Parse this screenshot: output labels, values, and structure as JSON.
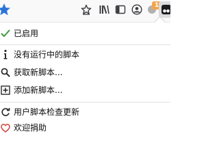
{
  "toolbar": {
    "buttons": [
      {
        "name": "bookmark-star",
        "icon": "star-icon"
      },
      {
        "name": "library",
        "icon": "library-icon"
      },
      {
        "name": "sidebars",
        "icon": "sidebar-icon"
      },
      {
        "name": "account",
        "icon": "account-icon"
      },
      {
        "name": "extension-badge",
        "icon": "extension-icon",
        "badge": "1"
      },
      {
        "name": "tampermonkey",
        "icon": "tampermonkey-icon"
      }
    ],
    "accent": "#2a73d8",
    "badge_color": "#f2a64b"
  },
  "menu": {
    "items": [
      {
        "label": "已启用",
        "icon": "checkmark-icon",
        "icon_color": "#3a9a3a"
      },
      {
        "label": "没有运行中的脚本",
        "icon": "info-icon"
      },
      {
        "label": "获取新脚本...",
        "icon": "search-icon"
      },
      {
        "label": "添加新脚本...",
        "icon": "add-square-icon"
      },
      {
        "label": "用户脚本检查更新",
        "icon": "refresh-icon"
      },
      {
        "label": "欢迎捐助",
        "icon": "heart-icon",
        "icon_color": "#d0463b"
      }
    ]
  }
}
